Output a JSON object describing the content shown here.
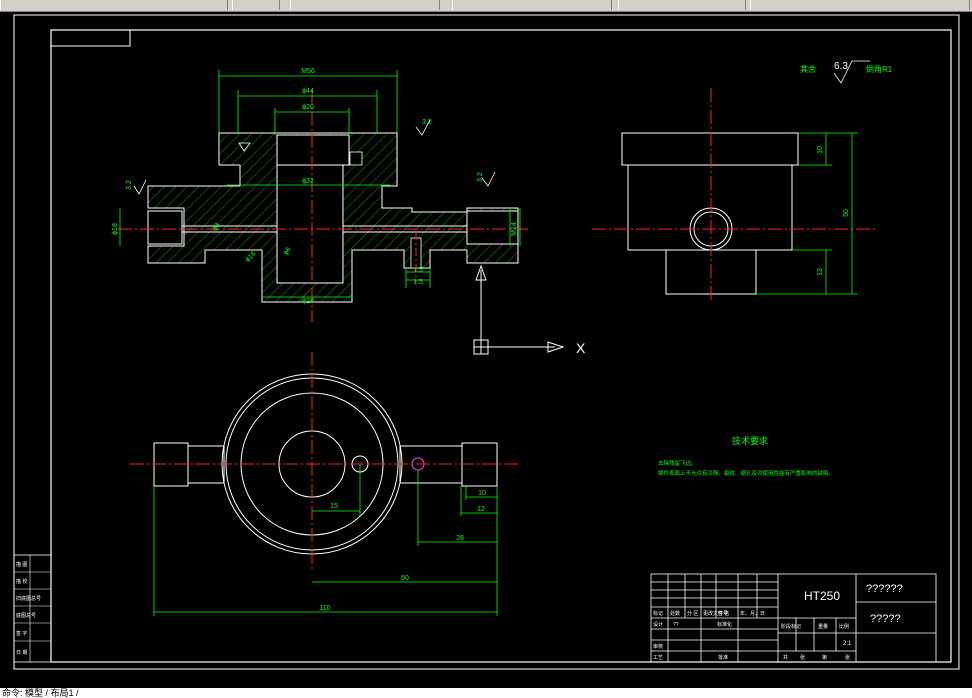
{
  "toolbar": {
    "segments": 6
  },
  "drawing": {
    "dims": {
      "m56": "M56",
      "d44": "ϕ44",
      "d20": "ϕ20",
      "d32": "ϕ32",
      "d28": "ϕ28",
      "d18": "ϕ18",
      "m14": "M14",
      "d8": "ϕ8",
      "d6": "ϕ6",
      "d16": "ϕ16",
      "c1": "1.5",
      "c2": "1.5",
      "side10": "10",
      "side50": "50",
      "side13": "13",
      "plan15": "15",
      "plan10": "10",
      "plan12": "12",
      "plan28": "28",
      "plan60": "60",
      "plan110": "110",
      "ra_left": "3.2",
      "ra_mid": "3.2",
      "ra_right": "3.2"
    },
    "roughness_note": {
      "prefix": "其余",
      "value": "6.3",
      "suffix": "倒角R1"
    },
    "axis_label": "X",
    "tech_req": {
      "title": "技术要求",
      "line1": "去除残留飞边。",
      "line2": "铸件表面上不允许有冷隔、裂纹、缩孔及对使用性能有严重影响的缺陷。"
    },
    "title_block": {
      "material": "HT250",
      "name": "??????",
      "drawing_no": "?????",
      "scale": "2:1",
      "hdr_marks": "标记",
      "hdr_count": "处数",
      "hdr_zone": "分 区",
      "hdr_docno": "更改文件号",
      "hdr_sign": "签 名",
      "hdr_date": "年、月、日",
      "design": "设计",
      "design_q": "??",
      "standard": "标准化",
      "stage": "阶段标记",
      "weight": "重量",
      "scale_label": "比例",
      "review": "审核",
      "process": "工艺",
      "approve": "批准",
      "sheets_total": "共",
      "sheet_unit": "张",
      "sheets_idx": "第",
      "sheet_unit2": "张"
    },
    "left_strip": [
      "描 图",
      "描 校",
      "旧底图总号",
      "底图总号",
      "签 字",
      "日 期"
    ]
  },
  "cmdline": {
    "text": "命令: 模型 / 布局1 /"
  }
}
